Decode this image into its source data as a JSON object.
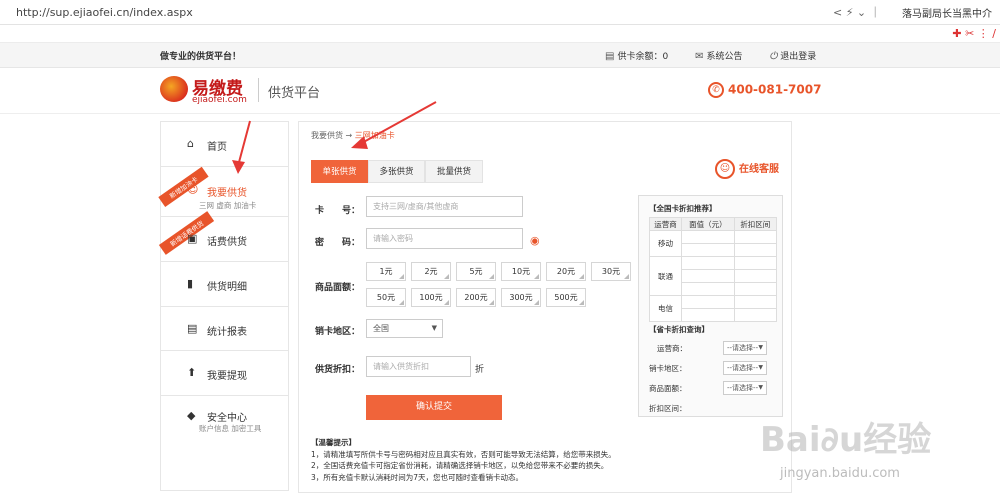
{
  "browser": {
    "url": "http://sup.ejiaofei.cn/index.aspx",
    "right_text": "落马副局长当黑中介",
    "icons": "< ⚡ ⌄ ｜",
    "tools": "✚ ✂ ⋮ ∕"
  },
  "topstrip": {
    "slogan": "做专业的供货平台！",
    "balance": "供卡余额：0",
    "notice": "系统公告",
    "logout": "退出登录"
  },
  "header": {
    "logo_text": "易缴费",
    "logo_sub": "ejiaofei.com",
    "platform": "供货平台",
    "phone": "400-081-7007",
    "phone_icon": "✆"
  },
  "sidebar": {
    "items": [
      {
        "icon": "⌂",
        "label": "首页",
        "sub": "",
        "ribbon": ""
      },
      {
        "icon": "☺",
        "label": "我要供货",
        "sub": "三网 虚商 加油卡",
        "ribbon": "新增加油卡"
      },
      {
        "icon": "▣",
        "label": "话费供货",
        "sub": "",
        "ribbon": "新增话费供货"
      },
      {
        "icon": "▮",
        "label": "供货明细",
        "sub": "",
        "ribbon": ""
      },
      {
        "icon": "▤",
        "label": "统计报表",
        "sub": "",
        "ribbon": ""
      },
      {
        "icon": "⬆",
        "label": "我要提现",
        "sub": "",
        "ribbon": ""
      },
      {
        "icon": "◆",
        "label": "安全中心",
        "sub": "账户信息 加密工具",
        "ribbon": ""
      }
    ]
  },
  "main": {
    "breadcrumb_root": "我要供货",
    "breadcrumb_sep": "→",
    "breadcrumb_current": "三网加油卡",
    "tabs": [
      "单张供货",
      "多张供货",
      "批量供货"
    ],
    "service": "在线客服",
    "service_icon": "☺",
    "card_label": "卡　　号：",
    "card_placeholder": "支持三网/虚商/其他虚商",
    "pwd_label": "密　　码：",
    "pwd_placeholder": "请输入密码",
    "eye_icon": "◉",
    "denom_label": "商品面额：",
    "denoms_row1": [
      "1元",
      "2元",
      "5元",
      "10元",
      "20元",
      "30元"
    ],
    "denoms_row2": [
      "50元",
      "100元",
      "200元",
      "300元",
      "500元"
    ],
    "region_label": "销卡地区：",
    "region_value": "全国",
    "discount_label": "供货折扣：",
    "discount_placeholder": "请输入供货折扣",
    "discount_unit": "折",
    "submit": "确认提交",
    "tips_title": "【温馨提示】",
    "tips": [
      "1，请精准填写所供卡号与密码相对应且真实有效，否则可能导致无法结算，给您带来损失。",
      "2，全国话费充值卡可指定省份消耗，请精确选择销卡地区，以免给您带来不必要的损失。",
      "3，所有充值卡默认消耗时间为7天，您也可随时查看销卡动态。"
    ]
  },
  "rightbox": {
    "title1": "【全国卡折扣推荐】",
    "headers": [
      "运营商",
      "面值（元）",
      "折扣区间"
    ],
    "carriers": [
      "移动",
      "联通",
      "电信"
    ],
    "title2": "【省卡折扣查询】",
    "carrier_label": "运营商：",
    "region_label": "销卡地区：",
    "denom_label": "商品面额：",
    "range_label": "折扣区间：",
    "select_placeholder": "--请选择--"
  },
  "watermark": {
    "brand": "Bai∂u经验",
    "site": "jingyan.baidu.com"
  },
  "colors": {
    "accent": "#f0643a",
    "brand": "#c41a1a"
  }
}
